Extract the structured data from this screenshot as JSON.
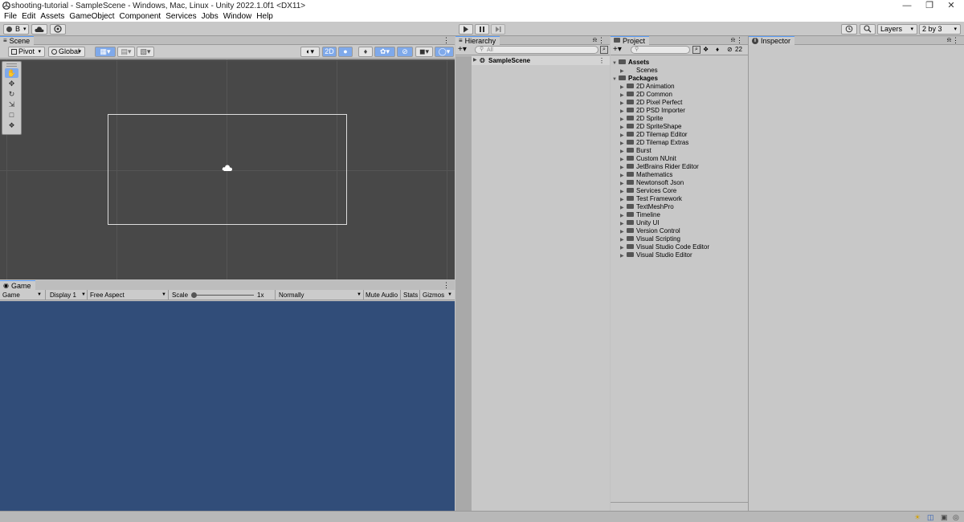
{
  "window": {
    "title": "shooting-tutorial - SampleScene - Windows, Mac, Linux - Unity 2022.1.0f1 <DX11>"
  },
  "menu": [
    "File",
    "Edit",
    "Assets",
    "GameObject",
    "Component",
    "Services",
    "Jobs",
    "Window",
    "Help"
  ],
  "toolbar": {
    "account_label": "B",
    "layers_label": "Layers",
    "layout_label": "2 by 3"
  },
  "scene": {
    "tab_label": "Scene",
    "pivot_label": "Pivot",
    "global_label": "Global",
    "mode_2d_label": "2D"
  },
  "game": {
    "tab_label": "Game",
    "view_label": "Game",
    "display_label": "Display 1",
    "aspect_label": "Free Aspect",
    "scale_label": "Scale",
    "scale_value": "1x",
    "play_mode_label": "Normally",
    "mute_audio_label": "Mute Audio",
    "stats_label": "Stats",
    "gizmos_label": "Gizmos"
  },
  "hierarchy": {
    "tab_label": "Hierarchy",
    "search_placeholder": "All",
    "scene_name": "SampleScene"
  },
  "project": {
    "tab_label": "Project",
    "hidden_count": "22",
    "assets_label": "Assets",
    "scenes_label": "Scenes",
    "packages_label": "Packages",
    "packages": [
      "2D Animation",
      "2D Common",
      "2D Pixel Perfect",
      "2D PSD Importer",
      "2D Sprite",
      "2D SpriteShape",
      "2D Tilemap Editor",
      "2D Tilemap Extras",
      "Burst",
      "Custom NUnit",
      "JetBrains Rider Editor",
      "Mathematics",
      "Newtonsoft Json",
      "Services Core",
      "Test Framework",
      "TextMeshPro",
      "Timeline",
      "Unity UI",
      "Version Control",
      "Visual Scripting",
      "Visual Studio Code Editor",
      "Visual Studio Editor"
    ]
  },
  "inspector": {
    "tab_label": "Inspector"
  },
  "colors": {
    "game_background": "#314d79",
    "scene_background": "#484848",
    "accent": "#5a9cf8"
  }
}
